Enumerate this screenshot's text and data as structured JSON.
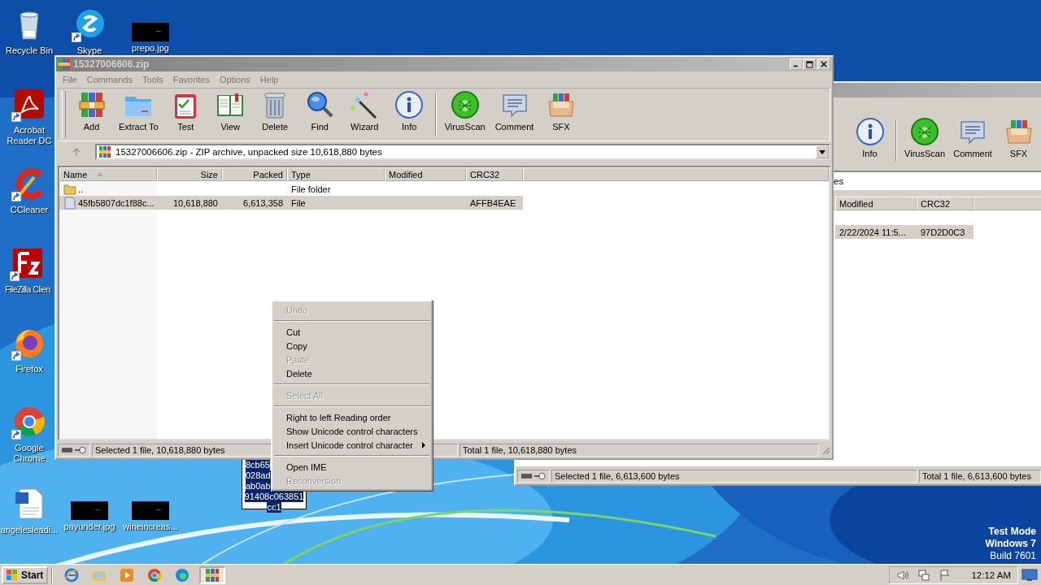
{
  "desktop_icons": [
    {
      "label": "Recycle Bin",
      "kind": "recycle",
      "shortcut": false
    },
    {
      "label": "Skype",
      "kind": "skype",
      "shortcut": true
    },
    {
      "label": "prepo.jpg",
      "shortcut": false
    },
    {
      "label": "Acrobat Reader DC",
      "kind": "acrobat",
      "shortcut": true
    },
    {
      "label": "CCleaner",
      "kind": "ccleaner",
      "shortcut": true
    },
    {
      "label": "FileZilla Clien",
      "kind": "filezilla",
      "shortcut": true
    },
    {
      "label": "Firefox",
      "kind": "firefox",
      "shortcut": true
    },
    {
      "label": "Google Chrome",
      "kind": "chrome",
      "shortcut": true
    },
    {
      "label": "angelesleadi...",
      "kind": "word",
      "shortcut": false
    },
    {
      "label": "payunder.jpg",
      "shortcut": false
    },
    {
      "label": "wineincreas...",
      "shortcut": false
    }
  ],
  "rename_box": {
    "lines": [
      "8cb65",
      "028ad",
      "ab0ab",
      "91408c063851",
      "cc1"
    ]
  },
  "back_window": {
    "toolbar": {
      "groups": [
        [
          {
            "label": "Info",
            "kind": "info"
          }
        ],
        [
          {
            "label": "VirusScan",
            "kind": "virusscan"
          },
          {
            "label": "Comment",
            "kind": "comment"
          },
          {
            "label": "SFX",
            "kind": "sfx"
          }
        ]
      ]
    },
    "address_tail": "es",
    "columns": [
      {
        "label": "Modified"
      },
      {
        "label": "CRC32"
      }
    ],
    "rows": [
      {
        "modified": "2/22/2024 11:5...",
        "crc32": "97D2D0C3",
        "selected": true
      }
    ],
    "status_bar": {
      "selection": "Selected 1 file, 6,613,600 bytes",
      "total": "Total 1 file, 6,613,600 bytes"
    }
  },
  "main_window": {
    "title": "15327006606.zip",
    "menu": [
      "File",
      "Commands",
      "Tools",
      "Favorites",
      "Options",
      "Help"
    ],
    "toolbar": {
      "groups": [
        [
          {
            "label": "Add",
            "kind": "add"
          },
          {
            "label": "Extract To",
            "kind": "extract"
          },
          {
            "label": "Test",
            "kind": "test"
          },
          {
            "label": "View",
            "kind": "view"
          },
          {
            "label": "Delete",
            "kind": "delete"
          },
          {
            "label": "Find",
            "kind": "find"
          },
          {
            "label": "Wizard",
            "kind": "wizard"
          },
          {
            "label": "Info",
            "kind": "info"
          }
        ],
        [
          {
            "label": "VirusScan",
            "kind": "virusscan"
          },
          {
            "label": "Comment",
            "kind": "comment"
          },
          {
            "label": "SFX",
            "kind": "sfx"
          }
        ]
      ]
    },
    "address": "15327006606.zip - ZIP archive, unpacked size 10,618,880 bytes",
    "columns": [
      {
        "label": "Name",
        "kind": "text",
        "sorted": true
      },
      {
        "label": "Size",
        "kind": "number",
        "sorted": false
      },
      {
        "label": "Packed",
        "kind": "number",
        "sorted": false
      },
      {
        "label": "Type",
        "kind": "text",
        "sorted": false
      },
      {
        "label": "Modified",
        "kind": "text",
        "sorted": false
      },
      {
        "label": "CRC32",
        "kind": "text",
        "sorted": false
      }
    ],
    "rows": [
      {
        "kind": "folder",
        "name": "..",
        "type": "File folder",
        "selected": false
      },
      {
        "kind": "file",
        "name": "45fb5807dc1f88c...",
        "size": "10,618,880",
        "packed": "6,613,358",
        "type": "File",
        "crc32": "AFFB4EAE",
        "selected": true
      }
    ],
    "status_bar": {
      "selection": "Selected 1 file, 10,618,880 bytes",
      "total": "Total 1 file, 10,618,880 bytes"
    }
  },
  "context_menu": [
    {
      "kind": "item",
      "label": "Undo",
      "disabled": true,
      "submenu": false
    },
    {
      "kind": "separator"
    },
    {
      "kind": "item",
      "label": "Cut",
      "disabled": false,
      "submenu": false
    },
    {
      "kind": "item",
      "label": "Copy",
      "disabled": false,
      "submenu": false
    },
    {
      "kind": "item",
      "label": "Paste",
      "disabled": true,
      "submenu": false
    },
    {
      "kind": "item",
      "label": "Delete",
      "disabled": false,
      "submenu": false
    },
    {
      "kind": "separator"
    },
    {
      "kind": "item",
      "label": "Select All",
      "disabled": true,
      "submenu": false
    },
    {
      "kind": "separator"
    },
    {
      "kind": "item",
      "label": "Right to left Reading order",
      "disabled": false,
      "submenu": false
    },
    {
      "kind": "item",
      "label": "Show Unicode control characters",
      "disabled": false,
      "submenu": false
    },
    {
      "kind": "item",
      "label": "Insert Unicode control character",
      "disabled": false,
      "submenu": true
    },
    {
      "kind": "separator"
    },
    {
      "kind": "item",
      "label": "Open IME",
      "disabled": false,
      "submenu": false
    },
    {
      "kind": "item",
      "label": "Reconversion",
      "disabled": true,
      "submenu": false
    }
  ],
  "test_mode_notice": {
    "mode": "Test Mode",
    "os": "Windows 7",
    "build": "Build 7601"
  },
  "taskbar": {
    "start": "Start",
    "apps": [
      {
        "kind": "ie",
        "active": false
      },
      {
        "kind": "explorer",
        "active": false
      },
      {
        "kind": "media",
        "active": false
      },
      {
        "kind": "chrome",
        "active": false
      },
      {
        "kind": "edge",
        "active": false
      },
      {
        "kind": "winrar",
        "active": true
      }
    ],
    "clock": "12:12 AM"
  }
}
